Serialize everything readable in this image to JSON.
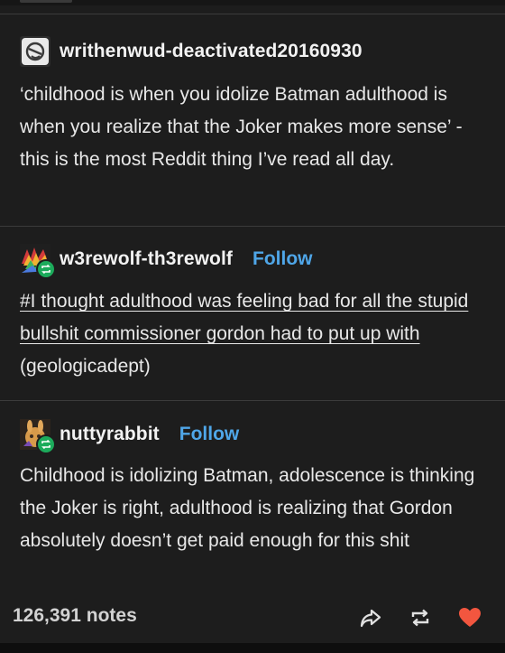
{
  "post1": {
    "username": "writhenwud-deactivated20160930",
    "text": "‘childhood is when you idolize Batman adulthood is when you realize that the Joker makes more sense’ - this is the most Reddit thing I’ve read all day."
  },
  "post2": {
    "username": "w3rewolf-th3rewolf",
    "follow_label": "Follow",
    "tag_text": "#I thought adulthood was feeling bad for all the stupid bullshit commissioner gordon had to put up with",
    "attribution": "(geologicadept)"
  },
  "post3": {
    "username": "nuttyrabbit",
    "follow_label": "Follow",
    "text": "Childhood is idolizing Batman, adolescence is thinking the Joker is right, adulthood is realizing that Gordon absolutely doesn’t get paid enough for this shit"
  },
  "footer": {
    "notes": "126,391 notes",
    "share_icon": "share-arrow-icon",
    "reblog_icon": "reblog-icon",
    "like_icon": "heart-icon",
    "like_color": "#f2563f"
  },
  "colors": {
    "background": "#1d1d1d",
    "follow": "#4fa6e8",
    "reblog_badge": "#1cab5b"
  }
}
